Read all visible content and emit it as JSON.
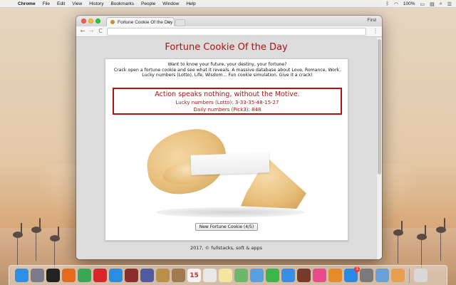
{
  "menubar": {
    "apple_glyph": "",
    "items": [
      "Chrome",
      "File",
      "Edit",
      "View",
      "History",
      "Bookmarks",
      "People",
      "Window",
      "Help"
    ],
    "battery": "100%",
    "right_icons": [
      "bluetooth-icon",
      "wifi-icon",
      "flag-icon",
      "search-icon",
      "list-icon"
    ]
  },
  "browser": {
    "tab_title": "Fortune Cookie Of the Day",
    "tab_close": "×",
    "profile": "First",
    "address": "",
    "back_glyph": "←",
    "forward_glyph": "→",
    "reload_glyph": "C",
    "menu_glyph": "⋮"
  },
  "page": {
    "title": "Fortune Cookie Of the Day",
    "intro_line1": "Want to know your future, your destiny, your fortune?",
    "intro_line2": "Crack open a fortune cookie and see what it reveals. A massive database about Love, Romance, Work,",
    "intro_line3": "Lucky numbers (Lotto), Life, Wisdom... Fun cookie simulation. Give it a crack!",
    "fortune_message": "Action speaks nothing, without the Motive.",
    "lucky_numbers": "Lucky numbers (Lotto): 3-33-35-48-15-27",
    "daily_numbers": "Daily numbers (Pick3): 848",
    "button_label": "New Fortune Cookie (4/5)",
    "footer": "2017, © fullstacks, soft & apps"
  },
  "colors": {
    "accent_red": "#b01212"
  },
  "dock": {
    "icons": [
      {
        "name": "finder-icon",
        "color": "#2e8fe8"
      },
      {
        "name": "launchpad-icon",
        "color": "#7a7a8a"
      },
      {
        "name": "terminal-icon",
        "color": "#222222"
      },
      {
        "name": "firefox-icon",
        "color": "#e66a1e"
      },
      {
        "name": "chrome-icon",
        "color": "#3aa757"
      },
      {
        "name": "opera-icon",
        "color": "#d9262c"
      },
      {
        "name": "safari-icon",
        "color": "#2a8de2"
      },
      {
        "name": "photo-booth-icon",
        "color": "#8b2d2d"
      },
      {
        "name": "apps-grid-icon",
        "color": "#4f5aa0"
      },
      {
        "name": "notes-icon",
        "color": "#b8904c"
      },
      {
        "name": "contacts-icon",
        "color": "#a07a50"
      },
      {
        "name": "calendar-icon",
        "color": "#f4f4f4"
      },
      {
        "name": "reminders-icon",
        "color": "#e8e8e8"
      },
      {
        "name": "stickies-icon",
        "color": "#f2e6a0"
      },
      {
        "name": "maps-icon",
        "color": "#6cb86c"
      },
      {
        "name": "photos-icon",
        "color": "#5aa0e0"
      },
      {
        "name": "facetime-icon",
        "color": "#3cb54a"
      },
      {
        "name": "messages-icon",
        "color": "#3a8ee6"
      },
      {
        "name": "photo-viewer-icon",
        "color": "#7a3a2a"
      },
      {
        "name": "itunes-icon",
        "color": "#e84a8a"
      },
      {
        "name": "ibooks-icon",
        "color": "#e88a2a"
      },
      {
        "name": "app-store-icon",
        "color": "#2a8ae6"
      },
      {
        "name": "system-preferences-icon",
        "color": "#7a7a7a"
      },
      {
        "name": "preview-icon",
        "color": "#6aa0d8"
      },
      {
        "name": "slideshow-icon",
        "color": "#e8a050"
      },
      {
        "name": "trash-icon",
        "color": "#d8d8d8"
      }
    ],
    "calendar_day": "15",
    "app_store_badge": "3"
  }
}
